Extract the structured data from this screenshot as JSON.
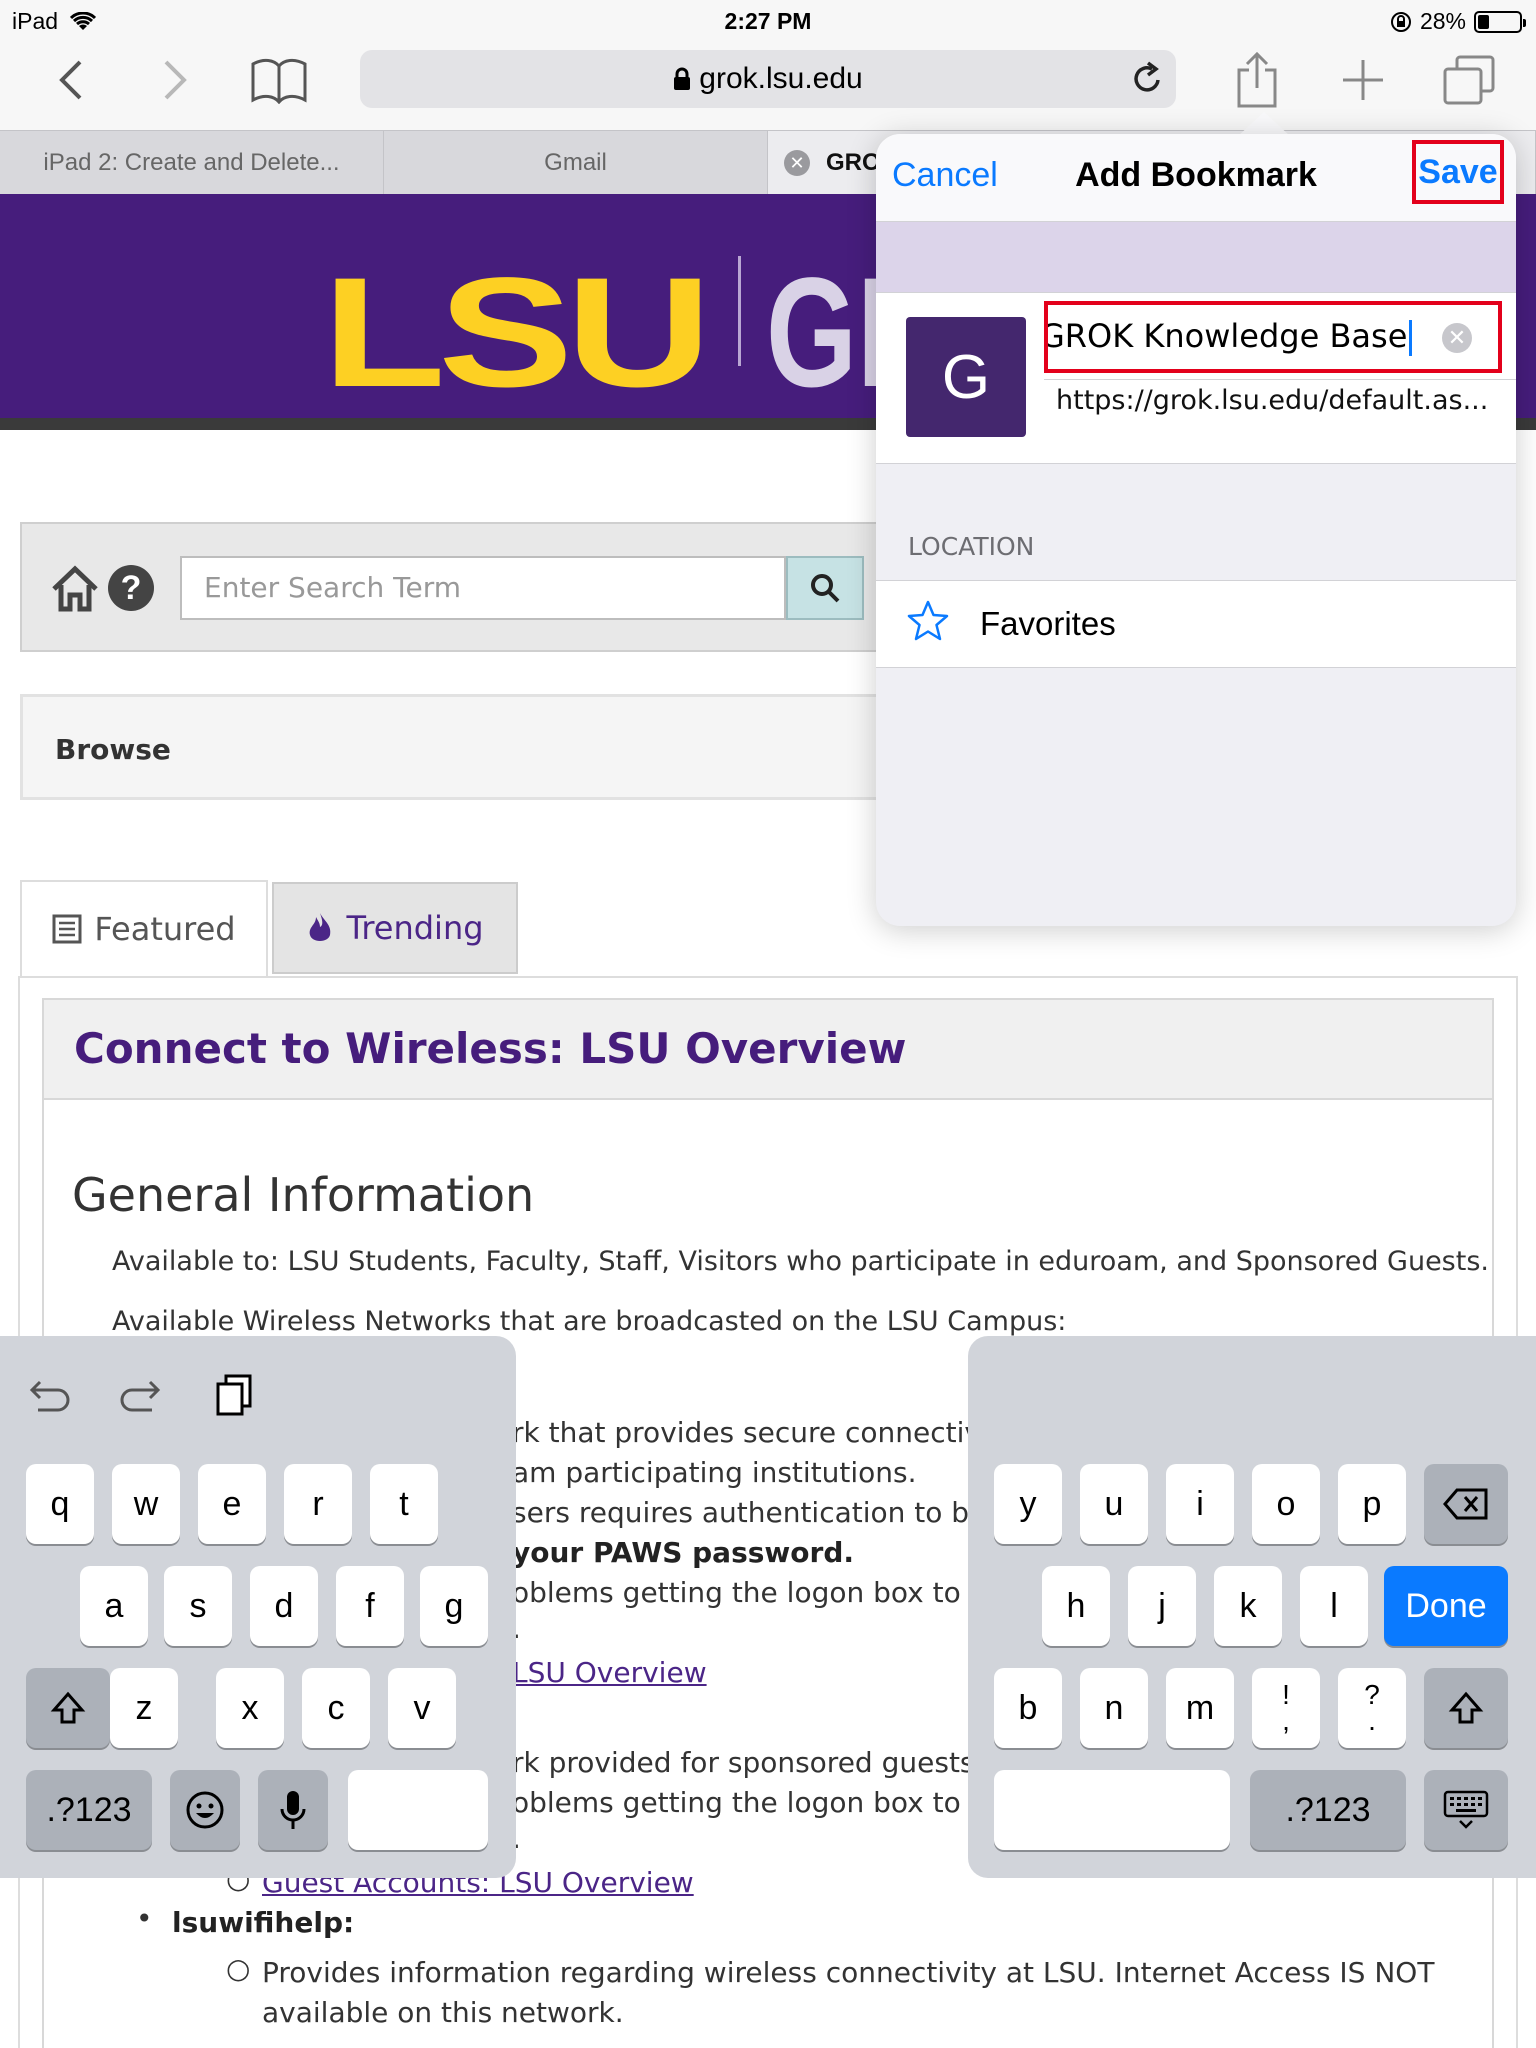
{
  "status": {
    "device": "iPad",
    "time": "2:27 PM",
    "battery": "28%",
    "battery_fraction": 0.28
  },
  "toolbar": {
    "url": "grok.lsu.edu"
  },
  "tabs": [
    {
      "label": "iPad 2: Create and Delete..."
    },
    {
      "label": "Gmail"
    },
    {
      "label": "GRO"
    }
  ],
  "banner": {
    "logo": "LSU",
    "logo_part": "GR"
  },
  "search": {
    "placeholder": "Enter Search Term"
  },
  "browse": {
    "label": "Browse"
  },
  "content_tabs": {
    "featured": "Featured",
    "trending": "Trending"
  },
  "article": {
    "title": "Connect to Wireless: LSU Overview",
    "heading": "General Information",
    "available_to": "Available to:  LSU Students, Faculty, Staff, Visitors who participate in eduroam, and Sponsored Guests.",
    "networks_intro": "Available Wireless Networks that are broadcasted on the LSU Campus:",
    "fragments": [
      "rk that provides secure connectivity",
      "am participating institutions.",
      "sers requires authentication to be e",
      "your PAWS password.",
      "oblems getting the logon box to dis",
      ".",
      "LSU Overview",
      "rk provided for sponsored guests o",
      "oblems getting the logon box to dis",
      "."
    ],
    "guest_link": "Guest Accounts: LSU Overview",
    "lsuwifihelp": "lsuwifihelp:",
    "lsuwifihelp_desc1": "Provides information regarding wireless connectivity at LSU. Internet Access IS NOT",
    "lsuwifihelp_desc2": "available on this network."
  },
  "bookmark": {
    "cancel": "Cancel",
    "title": "Add Bookmark",
    "save": "Save",
    "favicon_letter": "G",
    "name_value": "GROK Knowledge Base",
    "url": "https://grok.lsu.edu/default.as...",
    "location_label": "LOCATION",
    "location_value": "Favorites"
  },
  "keyboard": {
    "left_rows": [
      [
        "q",
        "w",
        "e",
        "r",
        "t"
      ],
      [
        "a",
        "s",
        "d",
        "f",
        "g"
      ],
      [
        "z",
        "x",
        "c",
        "v"
      ]
    ],
    "right_rows": [
      [
        "y",
        "u",
        "i",
        "o",
        "p"
      ],
      [
        "h",
        "j",
        "k",
        "l"
      ],
      [
        "b",
        "n",
        "m",
        "!\n,",
        "?\n."
      ]
    ],
    "numbers": ".?123",
    "done": "Done"
  },
  "colors": {
    "lsu_purple": "#461d7c",
    "lsu_gold": "#fdd023",
    "ios_blue": "#0a7aff",
    "highlight_red": "#e3001b"
  }
}
